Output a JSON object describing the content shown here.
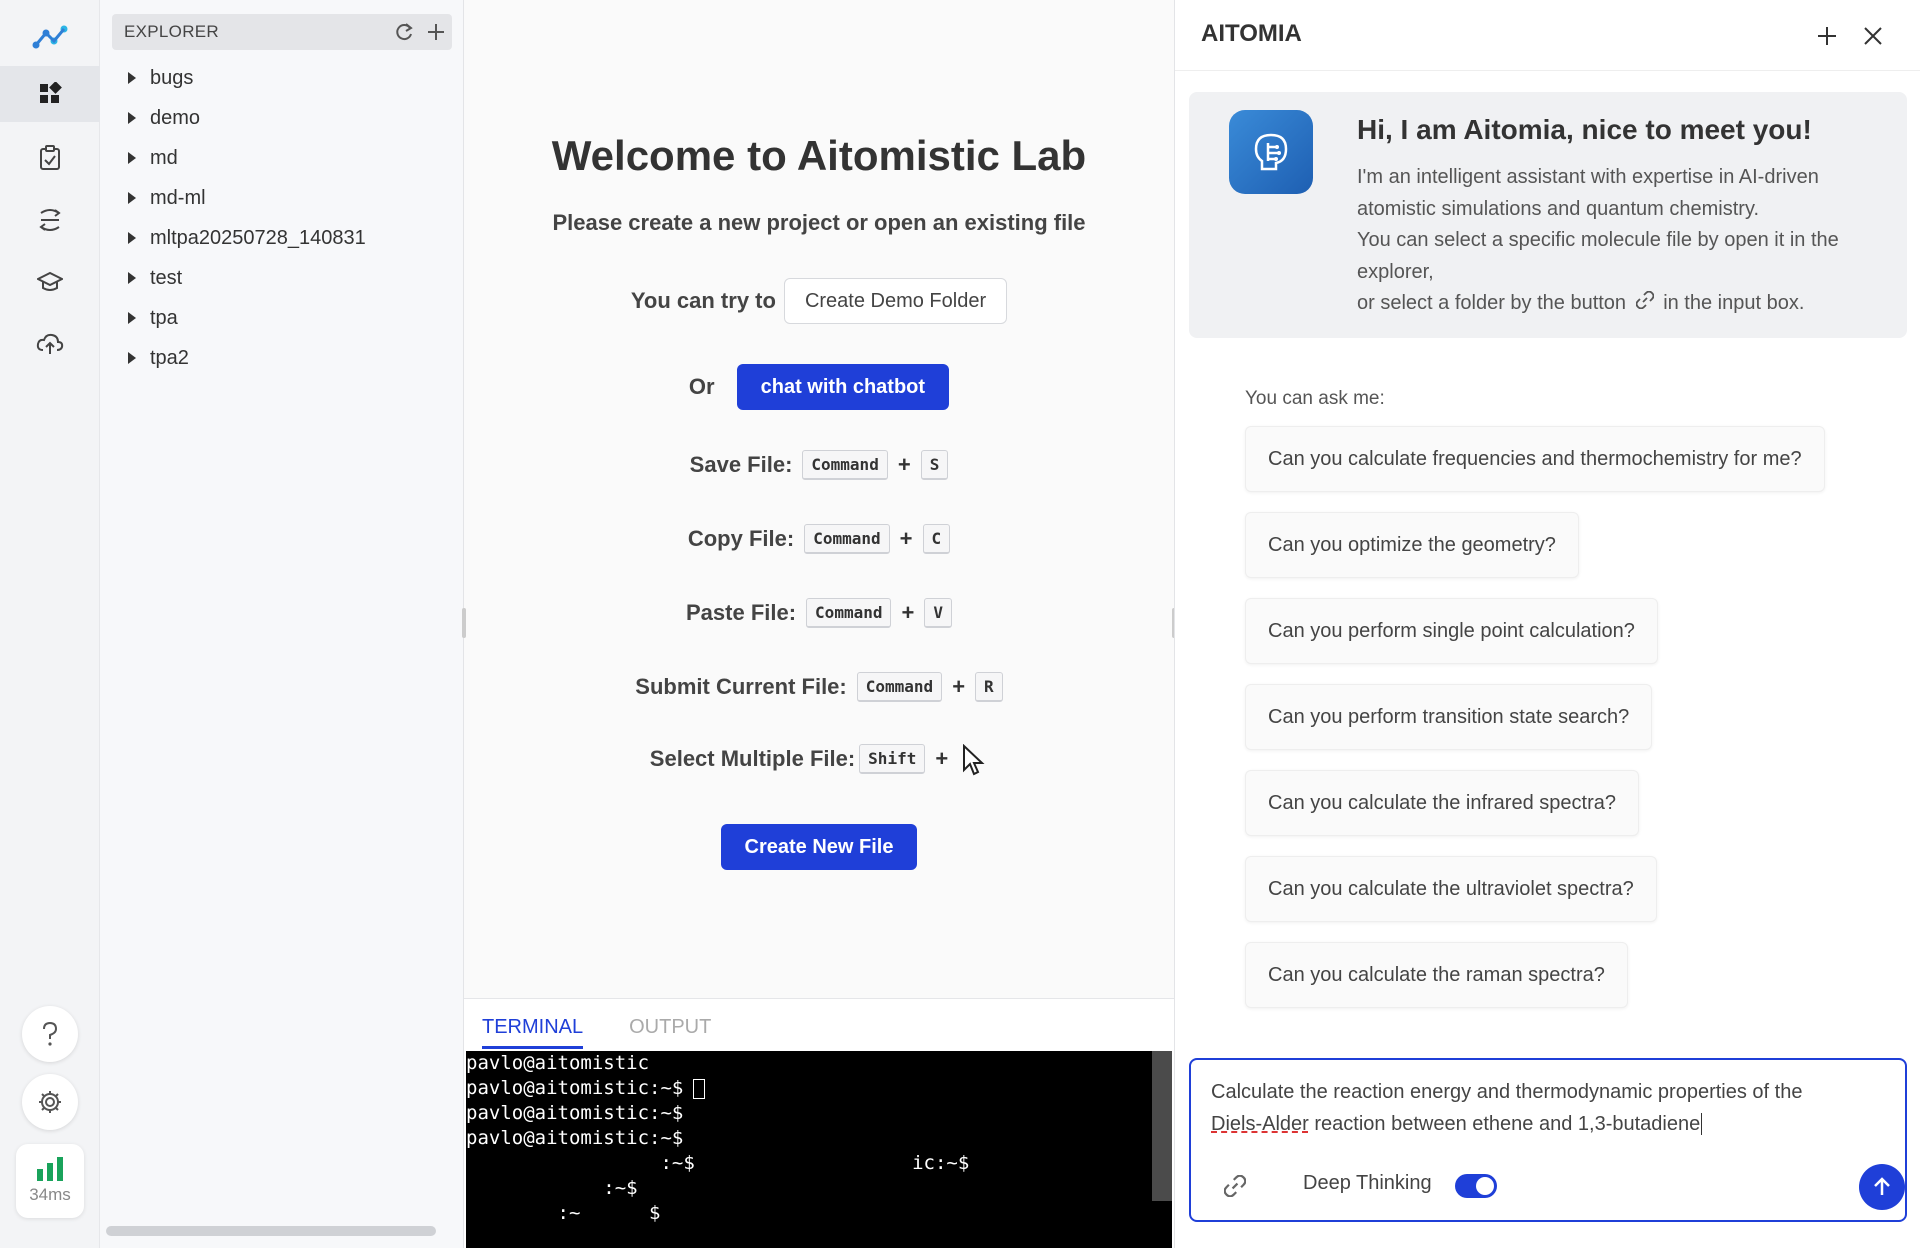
{
  "latency": "34ms",
  "explorer": {
    "title": "EXPLORER",
    "items": [
      "bugs",
      "demo",
      "md",
      "md-ml",
      "mltpa20250728_140831",
      "test",
      "tpa",
      "tpa2"
    ]
  },
  "welcome": {
    "title": "Welcome to Aitomistic Lab",
    "subtitle": "Please create a new project or open an existing file",
    "try_label": "You can try to",
    "demo_button": "Create Demo Folder",
    "or_label": "Or",
    "chat_button": "chat with chatbot",
    "shortcuts": [
      {
        "label": "Save File:",
        "mod": "Command",
        "key": "S"
      },
      {
        "label": "Copy File:",
        "mod": "Command",
        "key": "C"
      },
      {
        "label": "Paste File:",
        "mod": "Command",
        "key": "V"
      },
      {
        "label": "Submit Current File:",
        "mod": "Command",
        "key": "R"
      },
      {
        "label": "Select Multiple File:",
        "mod": "Shift",
        "key": ""
      }
    ],
    "plus": "+",
    "create_button": "Create New File"
  },
  "terminal": {
    "tabs": [
      "TERMINAL",
      "OUTPUT"
    ],
    "lines": [
      "pavlo@aitomistic",
      "pavlo@aitomistic:~$",
      "pavlo@aitomistic:~$",
      "pavlo@aitomistic:~$",
      "                 :~$                   ic:~$",
      "            :~$",
      "        :~      $"
    ]
  },
  "chat": {
    "title": "AITOMIA",
    "greeting_title": "Hi, I am Aitomia, nice to meet you!",
    "greeting_lines": [
      "I'm an intelligent assistant with expertise in AI-driven atomistic simulations and quantum chemistry.",
      "You can select a specific molecule file by open it in the explorer,",
      "or select a folder by the button",
      "in the input box."
    ],
    "ask_label": "You can ask me:",
    "suggestions": [
      "Can you calculate frequencies and thermochemistry for me?",
      "Can you optimize the geometry?",
      "Can you perform single point calculation?",
      "Can you perform transition state search?",
      "Can you calculate the infrared spectra?",
      "Can you calculate the ultraviolet spectra?",
      "Can you calculate the raman spectra?"
    ],
    "input_text_1": "Calculate the reaction energy and thermodynamic properties of the",
    "input_text_2a": "Diels-Alder",
    "input_text_2b": " reaction between ethene and 1,3-butadiene",
    "deep_thinking_label": "Deep Thinking",
    "deep_thinking_on": true
  },
  "colors": {
    "accent": "#1f3fd8",
    "latency_bar": "#19a35b"
  }
}
